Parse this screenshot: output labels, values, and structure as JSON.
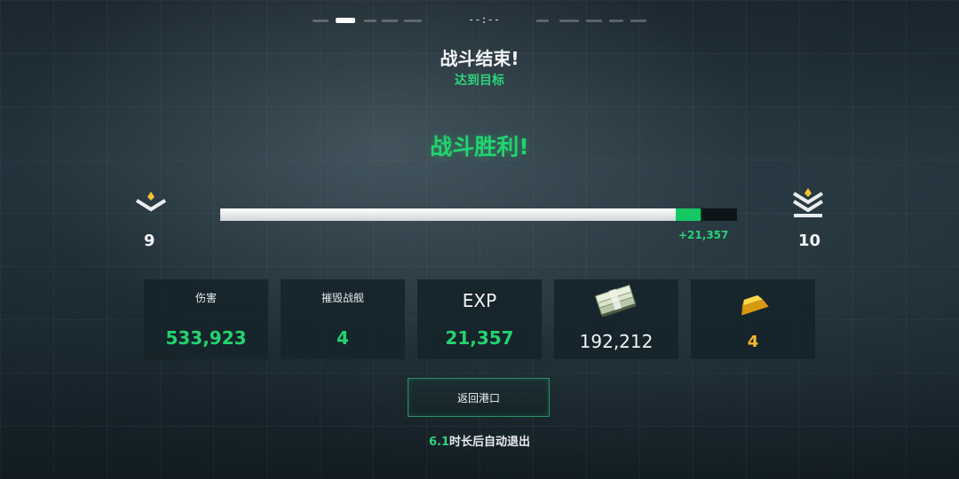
{
  "status_bar": {
    "clock": "--:--"
  },
  "header": {
    "title": "战斗结束!",
    "subtitle": "达到目标",
    "result": "战斗胜利!"
  },
  "progress": {
    "current_rank": "9",
    "next_rank": "10",
    "xp_gain": "+21,357",
    "base_fraction": 0.882,
    "gain_fraction": 0.05
  },
  "stats": [
    {
      "label": "伤害",
      "value": "533,923"
    },
    {
      "label": "摧毁战舰",
      "value": "4"
    },
    {
      "label": "EXP",
      "value": "21,357"
    },
    {
      "icon": "cash-stack-icon",
      "value": "192,212"
    },
    {
      "icon": "gold-bar-icon",
      "value": "4"
    }
  ],
  "actions": {
    "return_label": "返回港口"
  },
  "footer": {
    "countdown": "6.1",
    "exit_text": "时长后自动退出"
  },
  "colors": {
    "accent_green": "#22d36f",
    "gold": "#f5b82a",
    "card_bg": "#16242a"
  }
}
